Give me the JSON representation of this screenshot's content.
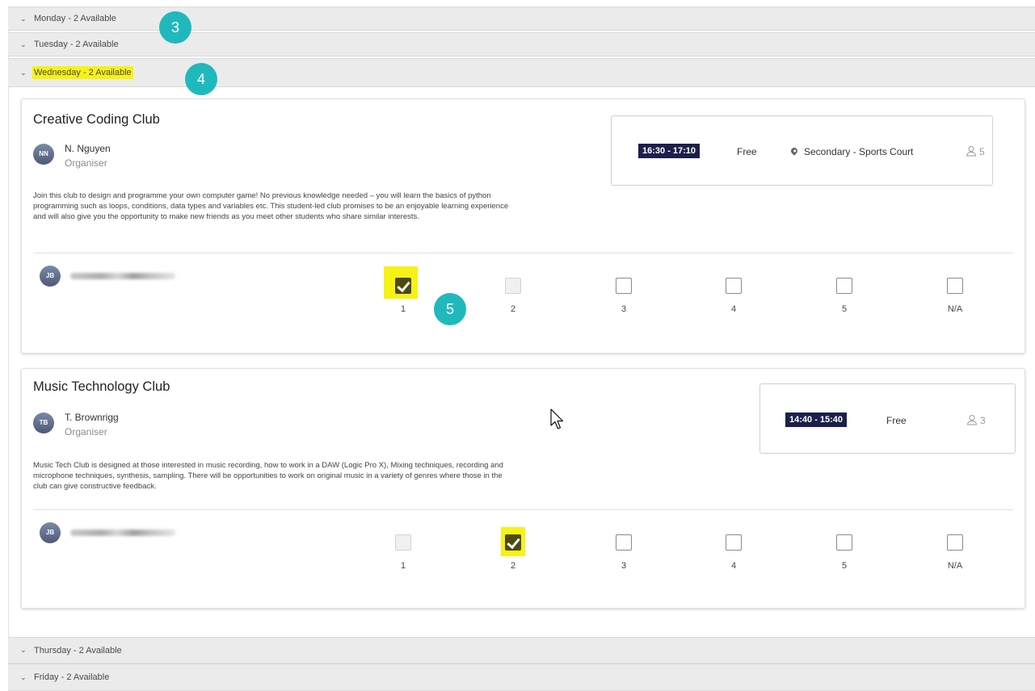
{
  "days": [
    {
      "label": "Monday - 2 Available"
    },
    {
      "label": "Tuesday - 2 Available"
    },
    {
      "label": "Wednesday - 2 Available"
    },
    {
      "label": "Thursday - 2 Available"
    },
    {
      "label": "Friday - 2 Available"
    }
  ],
  "badges": [
    "3",
    "4",
    "5"
  ],
  "clubs": [
    {
      "title": "Creative Coding Club",
      "organiser_initials": "NN",
      "organiser_name": "N. Nguyen",
      "organiser_role": "Organiser",
      "description": "Join this club to design and programme your own computer game! No previous knowledge needed – you will learn the basics of python programming such as loops, conditions, data types and variables etc. This student-led club promises to be an enjoyable learning experience and will also give you the opportunity to make new friends as you meet other students who share similar interests.",
      "time": "16:30 - 17:10",
      "cost": "Free",
      "location": "Secondary - Sports Court",
      "capacity": "5",
      "student_initials": "JB",
      "choices": [
        {
          "label": "1",
          "state": "checked",
          "highlighted": true
        },
        {
          "label": "2",
          "state": "disabled",
          "highlighted": false
        },
        {
          "label": "3",
          "state": "empty",
          "highlighted": false
        },
        {
          "label": "4",
          "state": "empty",
          "highlighted": false
        },
        {
          "label": "5",
          "state": "empty",
          "highlighted": false
        },
        {
          "label": "N/A",
          "state": "empty",
          "highlighted": false
        }
      ]
    },
    {
      "title": "Music Technology Club",
      "organiser_initials": "TB",
      "organiser_name": "T. Brownrigg",
      "organiser_role": "Organiser",
      "description": "Music Tech Club is designed at those interested in music recording, how to work in a DAW (Logic Pro X), Mixing techniques, recording and microphone techniques, synthesis, sampling. There will be opportunities to work on original music in a variety of genres where those in the club can give constructive feedback.",
      "time": "14:40 - 15:40",
      "cost": "Free",
      "capacity": "3",
      "student_initials": "JB",
      "choices": [
        {
          "label": "1",
          "state": "disabled",
          "highlighted": false
        },
        {
          "label": "2",
          "state": "checked",
          "highlighted": true
        },
        {
          "label": "3",
          "state": "empty",
          "highlighted": false
        },
        {
          "label": "4",
          "state": "empty",
          "highlighted": false
        },
        {
          "label": "5",
          "state": "empty",
          "highlighted": false
        },
        {
          "label": "N/A",
          "state": "empty",
          "highlighted": false
        }
      ]
    }
  ],
  "colors": {
    "highlight": "#f7f215",
    "badge": "#1fb9bd",
    "time_badge": "#1c1f4a",
    "checked": "#4d4a10"
  }
}
